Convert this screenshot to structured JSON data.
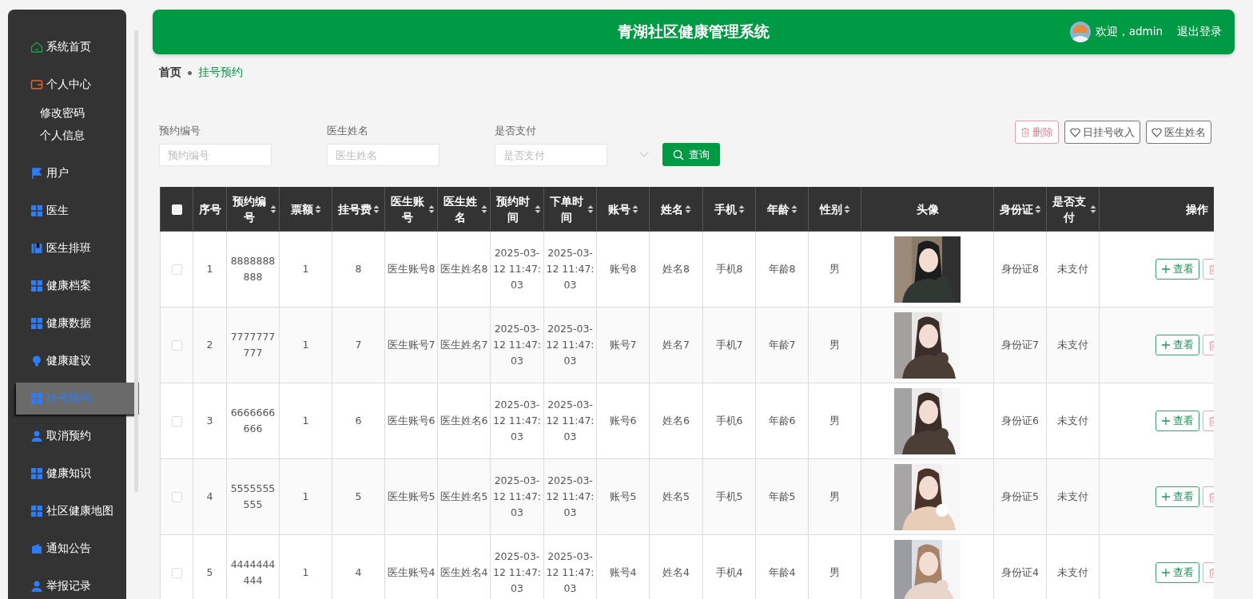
{
  "sidebar": {
    "items": [
      {
        "label": "系统首页",
        "selected": false
      },
      {
        "label": "个人中心",
        "selected": false,
        "children": [
          {
            "label": "修改密码",
            "selected": false
          },
          {
            "label": "个人信息",
            "selected": false
          }
        ]
      },
      {
        "label": "用户",
        "selected": false
      },
      {
        "label": "医生",
        "selected": false
      },
      {
        "label": "医生排班",
        "selected": false
      },
      {
        "label": "健康档案",
        "selected": false
      },
      {
        "label": "健康数据",
        "selected": false
      },
      {
        "label": "健康建议",
        "selected": false
      },
      {
        "label": "挂号预约",
        "selected": true
      },
      {
        "label": "取消预约",
        "selected": false
      },
      {
        "label": "健康知识",
        "selected": false
      },
      {
        "label": "社区健康地图",
        "selected": false
      },
      {
        "label": "通知公告",
        "selected": false
      },
      {
        "label": "举报记录",
        "selected": false
      }
    ]
  },
  "header": {
    "title": "青湖社区健康管理系统",
    "welcome": "欢迎，admin",
    "logout": "退出登录"
  },
  "breadcrumb": [
    {
      "label": "首页",
      "selected": false
    },
    {
      "label": "挂号预约",
      "selected": true
    }
  ],
  "search": {
    "fields": [
      {
        "kind": "text",
        "label": "预约编号",
        "placeholder": "预约编号"
      },
      {
        "kind": "text",
        "label": "医生姓名",
        "placeholder": "医生姓名"
      },
      {
        "kind": "select",
        "label": "是否支付",
        "placeholder": "是否支付"
      }
    ],
    "button": "查询"
  },
  "tools": [
    {
      "kind": "delete",
      "label": "删除"
    },
    {
      "kind": "heart",
      "label": "日挂号收入"
    },
    {
      "kind": "heart",
      "label": "医生姓名"
    }
  ],
  "table": {
    "columns": [
      {
        "kind": "checkbox",
        "checked": false
      },
      {
        "label": "序号",
        "sortable": false
      },
      {
        "label": "预约编号",
        "sortable": true
      },
      {
        "label": "票额",
        "sortable": true
      },
      {
        "label": "挂号费",
        "sortable": true
      },
      {
        "label": "医生账号",
        "sortable": true
      },
      {
        "label": "医生姓名",
        "sortable": true
      },
      {
        "label": "预约时间",
        "sortable": true
      },
      {
        "label": "下单时间",
        "sortable": true
      },
      {
        "label": "账号",
        "sortable": true
      },
      {
        "label": "姓名",
        "sortable": true
      },
      {
        "label": "手机",
        "sortable": true
      },
      {
        "label": "年龄",
        "sortable": true
      },
      {
        "label": "性别",
        "sortable": true
      },
      {
        "label": "头像",
        "sortable": false
      },
      {
        "label": "身份证",
        "sortable": true
      },
      {
        "label": "是否支付",
        "sortable": true
      },
      {
        "label": "操作",
        "sortable": false
      }
    ],
    "rows": [
      {
        "checked": false,
        "values": [
          "1",
          "8888888888",
          "1",
          "8",
          "医生账号8",
          "医生姓名8",
          "2025-03-12 11:47:03",
          "2025-03-12 11:47:03",
          "账号8",
          "姓名8",
          "手机8",
          "年龄8",
          "男"
        ],
        "photo": {
          "kind": "picture"
        },
        "tail": [
          "身份证8",
          "未支付"
        ],
        "actions": [
          {
            "kind": "view",
            "label": "查看"
          },
          {
            "kind": "delete"
          }
        ]
      },
      {
        "checked": false,
        "values": [
          "2",
          "7777777777",
          "1",
          "7",
          "医生账号7",
          "医生姓名7",
          "2025-03-12 11:47:03",
          "2025-03-12 11:47:03",
          "账号7",
          "姓名7",
          "手机7",
          "年龄7",
          "男"
        ],
        "photo": {
          "kind": "picture"
        },
        "tail": [
          "身份证7",
          "未支付"
        ],
        "actions": [
          {
            "kind": "view",
            "label": "查看"
          },
          {
            "kind": "delete"
          }
        ]
      },
      {
        "checked": false,
        "values": [
          "3",
          "6666666666",
          "1",
          "6",
          "医生账号6",
          "医生姓名6",
          "2025-03-12 11:47:03",
          "2025-03-12 11:47:03",
          "账号6",
          "姓名6",
          "手机6",
          "年龄6",
          "男"
        ],
        "photo": {
          "kind": "picture"
        },
        "tail": [
          "身份证6",
          "未支付"
        ],
        "actions": [
          {
            "kind": "view",
            "label": "查看"
          },
          {
            "kind": "delete"
          }
        ]
      },
      {
        "checked": false,
        "values": [
          "4",
          "5555555555",
          "1",
          "5",
          "医生账号5",
          "医生姓名5",
          "2025-03-12 11:47:03",
          "2025-03-12 11:47:03",
          "账号5",
          "姓名5",
          "手机5",
          "年龄5",
          "男"
        ],
        "photo": {
          "kind": "picture"
        },
        "tail": [
          "身份证5",
          "未支付"
        ],
        "actions": [
          {
            "kind": "view",
            "label": "查看"
          },
          {
            "kind": "delete"
          }
        ]
      },
      {
        "checked": false,
        "values": [
          "5",
          "4444444444",
          "1",
          "4",
          "医生账号4",
          "医生姓名4",
          "2025-03-12 11:47:03",
          "2025-03-12 11:47:03",
          "账号4",
          "姓名4",
          "手机4",
          "年龄4",
          "男"
        ],
        "photo": {
          "kind": "picture"
        },
        "tail": [
          "身份证4",
          "未支付"
        ],
        "actions": [
          {
            "kind": "view",
            "label": "查看"
          },
          {
            "kind": "delete"
          }
        ]
      }
    ]
  }
}
